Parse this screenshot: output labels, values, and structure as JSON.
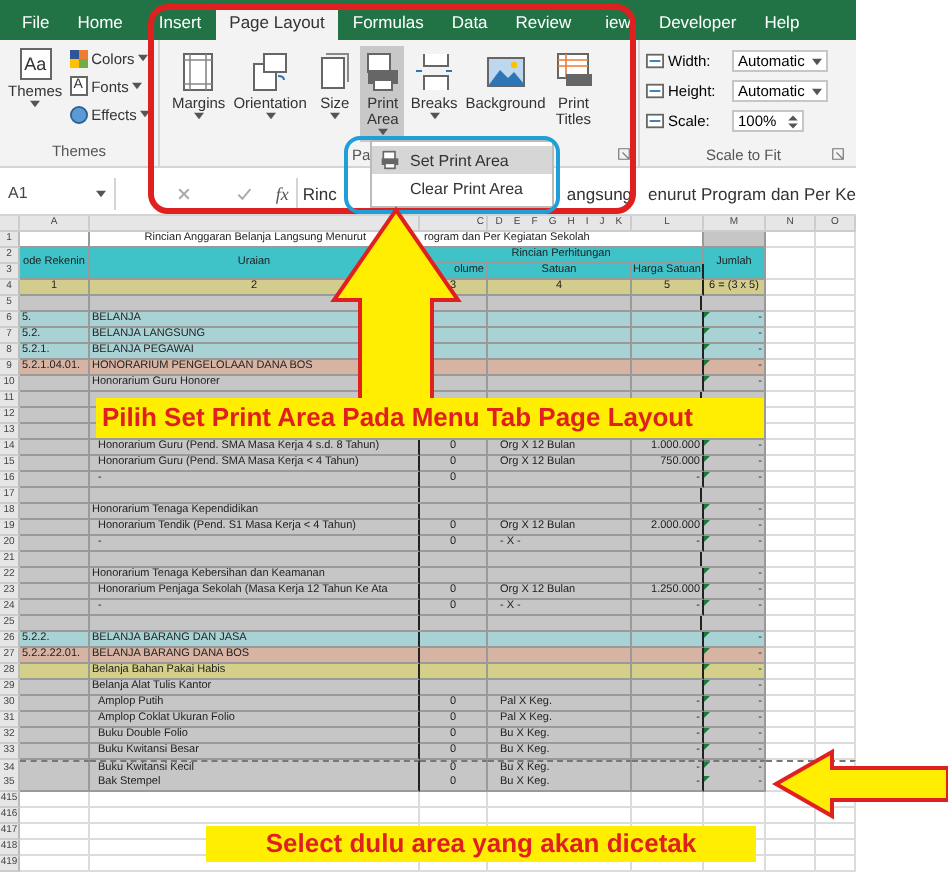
{
  "ribbon_tabs": [
    {
      "label": "File",
      "selected": false
    },
    {
      "label": "Home",
      "selected": false
    },
    {
      "label": "Insert",
      "selected": false
    },
    {
      "label": "Page Layout",
      "selected": true
    },
    {
      "label": "Formulas",
      "selected": false
    },
    {
      "label": "Data",
      "selected": false
    },
    {
      "label": "Review",
      "selected": false
    },
    {
      "label": "iew",
      "selected": false
    },
    {
      "label": "Developer",
      "selected": false
    },
    {
      "label": "Help",
      "selected": false
    }
  ],
  "themes_group": {
    "icon_text": "Aa",
    "button": "Themes",
    "options": [
      {
        "label": "Colors"
      },
      {
        "label": "Fonts"
      },
      {
        "label": "Effects"
      }
    ],
    "label": "Themes",
    "fonts_icon_text": "A"
  },
  "page_setup_group": {
    "label": "Pa",
    "buttons": [
      {
        "lines": [
          "Margins"
        ],
        "dropdown": true,
        "selected": false
      },
      {
        "lines": [
          "Orientation"
        ],
        "dropdown": true,
        "selected": false
      },
      {
        "lines": [
          "Size"
        ],
        "dropdown": true,
        "selected": false
      },
      {
        "lines": [
          "Print",
          "Area"
        ],
        "dropdown": true,
        "selected": true
      },
      {
        "lines": [
          "Breaks"
        ],
        "dropdown": true,
        "selected": false
      },
      {
        "lines": [
          "Background"
        ],
        "dropdown": false,
        "selected": false
      },
      {
        "lines": [
          "Print",
          "Titles"
        ],
        "dropdown": false,
        "selected": false
      }
    ]
  },
  "scale_group": {
    "label": "Scale to Fit",
    "fields": [
      {
        "label": "Width:",
        "value": "Automatic",
        "kind": "dropdown"
      },
      {
        "label": "Height:",
        "value": "Automatic",
        "kind": "dropdown"
      },
      {
        "label": "Scale:",
        "value": "100%",
        "kind": "spinner"
      }
    ]
  },
  "print_area_menu": [
    {
      "label": "Set Print Area",
      "selected": true
    },
    {
      "label": "Clear Print Area",
      "selected": false
    }
  ],
  "formula_bar": {
    "name_box": "A1",
    "fx": "fx",
    "text_parts": [
      "Rinc",
      "angsung",
      "enurut Program dan Per Ke"
    ]
  },
  "column_letters": {
    "a": "A",
    "c": "C",
    "d_k": [
      "D",
      "E",
      "F",
      "G",
      "H",
      "I",
      "J",
      "K"
    ],
    "l": "L",
    "m": "M",
    "n": "N",
    "o": "O"
  },
  "title_row": {
    "n": "1",
    "parts": [
      "Rincian Anggaran Belanja Langsung Menurut",
      "rogram dan Per Kegiatan Sekolah"
    ]
  },
  "header_rows": {
    "numbers": [
      "2",
      "3"
    ],
    "code": "ode Rekenin",
    "uraian": "Uraian",
    "group": "Rincian Perhitungan",
    "volume": "olume",
    "satuan": "Satuan",
    "harga": "Harga Satuan",
    "jumlah": "Jumlah"
  },
  "index_row": {
    "n": "4",
    "cells": [
      "1",
      "2",
      "3",
      "4",
      "5",
      "6 = (3 x 5)"
    ]
  },
  "rows": [
    {
      "n": "5",
      "color": "#c6c6c6",
      "flag": false
    },
    {
      "n": "6",
      "code": "5.",
      "text": "BELANJA",
      "kind": "group",
      "color": "#a9d2d5",
      "flag": true,
      "jumlah": "-"
    },
    {
      "n": "7",
      "code": "5.2.",
      "text": "BELANJA LANGSUNG",
      "kind": "group",
      "color": "#a9d2d5",
      "flag": true,
      "jumlah": "-"
    },
    {
      "n": "8",
      "code": "5.2.1.",
      "text": "BELANJA PEGAWAI",
      "kind": "group",
      "color": "#a9d2d5",
      "flag": true,
      "jumlah": "-"
    },
    {
      "n": "9",
      "code": "5.2.1.04.01.",
      "text": "HONORARIUM PENGELOLAAN DANA BOS",
      "kind": "group",
      "color": "#d6b3a3",
      "flag": true,
      "jumlah": "-"
    },
    {
      "n": "10",
      "text": "Honorarium Guru Honorer",
      "kind": "group",
      "color": "#c6c6c6",
      "flag": true,
      "jumlah": "-"
    },
    {
      "n": "11",
      "color": "#c6c6c6",
      "flag": false
    },
    {
      "n": "12",
      "color": "#c6c6c6",
      "flag": false
    },
    {
      "n": "13",
      "color": "#c6c6c6",
      "flag": false
    },
    {
      "n": "14",
      "text": "Honorarium Guru (Pend. SMA Masa Kerja 4 s.d. 8 Tahun)",
      "kind": "item",
      "volume": "0",
      "satuan": "Org X 12 Bulan",
      "harga": "1.000.000",
      "color": "#c6c6c6",
      "flag": true,
      "jumlah": "-"
    },
    {
      "n": "15",
      "text": "Honorarium Guru (Pend. SMA Masa Kerja < 4 Tahun)",
      "kind": "item",
      "volume": "0",
      "satuan": "Org X 12 Bulan",
      "harga": "750.000",
      "color": "#c6c6c6",
      "flag": true,
      "jumlah": "-"
    },
    {
      "n": "16",
      "text": "-",
      "kind": "item",
      "volume": "0",
      "harga": "-",
      "color": "#c6c6c6",
      "flag": true,
      "jumlah": "-"
    },
    {
      "n": "17",
      "color": "#c6c6c6",
      "flag": false
    },
    {
      "n": "18",
      "text": "Honorarium Tenaga Kependidikan",
      "kind": "group",
      "color": "#c6c6c6",
      "flag": true,
      "jumlah": "-"
    },
    {
      "n": "19",
      "text": "Honorarium Tendik (Pend. S1 Masa Kerja < 4 Tahun)",
      "kind": "item",
      "volume": "0",
      "satuan": "Org X 12 Bulan",
      "harga": "2.000.000",
      "color": "#c6c6c6",
      "flag": true,
      "jumlah": "-"
    },
    {
      "n": "20",
      "text": "-",
      "kind": "item",
      "volume": "0",
      "satuan": "- X -",
      "harga": "-",
      "color": "#c6c6c6",
      "flag": true,
      "jumlah": "-"
    },
    {
      "n": "21",
      "color": "#c6c6c6",
      "flag": false
    },
    {
      "n": "22",
      "text": "Honorarium Tenaga Kebersihan dan Keamanan",
      "kind": "group",
      "color": "#c6c6c6",
      "flag": true,
      "jumlah": "-"
    },
    {
      "n": "23",
      "text": "Honorarium Penjaga Sekolah (Masa Kerja 12 Tahun Ke Ata",
      "kind": "item",
      "volume": "0",
      "satuan": "Org X 12 Bulan",
      "harga": "1.250.000",
      "color": "#c6c6c6",
      "flag": true,
      "jumlah": "-"
    },
    {
      "n": "24",
      "text": "-",
      "kind": "item",
      "volume": "0",
      "satuan": "- X -",
      "harga": "-",
      "color": "#c6c6c6",
      "flag": true,
      "jumlah": "-"
    },
    {
      "n": "25",
      "color": "#c6c6c6",
      "flag": false
    },
    {
      "n": "26",
      "code": "5.2.2.",
      "text": "BELANJA BARANG DAN JASA",
      "kind": "group",
      "color": "#a9d2d5",
      "flag": true,
      "jumlah": "-"
    },
    {
      "n": "27",
      "code": "5.2.2.22.01.",
      "text": "BELANJA BARANG DANA BOS",
      "kind": "group",
      "color": "#d6b3a3",
      "flag": true,
      "jumlah": "-"
    },
    {
      "n": "28",
      "text": "Belanja Bahan Pakai Habis",
      "kind": "group",
      "color": "#d4d08a",
      "flag": true,
      "jumlah": "-"
    },
    {
      "n": "29",
      "text": "Belanja Alat Tulis Kantor",
      "kind": "group",
      "color": "#c6c6c6",
      "flag": true,
      "jumlah": "-"
    },
    {
      "n": "30",
      "text": "Amplop Putih",
      "kind": "item",
      "volume": "0",
      "satuan": "Pal X Keg.",
      "harga": "-",
      "color": "#c6c6c6",
      "flag": true,
      "jumlah": "-"
    },
    {
      "n": "31",
      "text": "Amplop Coklat Ukuran Folio",
      "kind": "item",
      "volume": "0",
      "satuan": "Pal X Keg.",
      "harga": "-",
      "color": "#c6c6c6",
      "flag": true,
      "jumlah": "-"
    },
    {
      "n": "32",
      "text": "Buku Double Folio",
      "kind": "item",
      "volume": "0",
      "satuan": "Bu X Keg.",
      "harga": "-",
      "color": "#c6c6c6",
      "flag": true,
      "jumlah": "-"
    },
    {
      "n": "33",
      "text": "Buku Kwitansi Besar",
      "kind": "item",
      "volume": "0",
      "satuan": "Bu X Keg.",
      "harga": "-",
      "color": "#c6c6c6",
      "flag": true,
      "jumlah": "-"
    },
    {
      "n": "34",
      "text": "Buku Kwitansi Kecil",
      "kind": "item",
      "volume": "0",
      "satuan": "Bu X Keg.",
      "harga": "-",
      "color": "#c6c6c6",
      "flag": true,
      "jumlah": "-"
    },
    {
      "n": "35",
      "text": "Bak Stempel",
      "kind": "item",
      "volume": "0",
      "satuan": "Bu X Keg.",
      "harga": "-",
      "color": "#c6c6c6",
      "flag": true,
      "jumlah": "-"
    }
  ],
  "trailing_rows": [
    "415",
    "416",
    "417",
    "418",
    "419"
  ],
  "annotations": {
    "top_banner": "Pilih Set Print Area Pada Menu Tab Page Layout",
    "bottom_banner": "Select dulu area yang akan dicetak"
  }
}
